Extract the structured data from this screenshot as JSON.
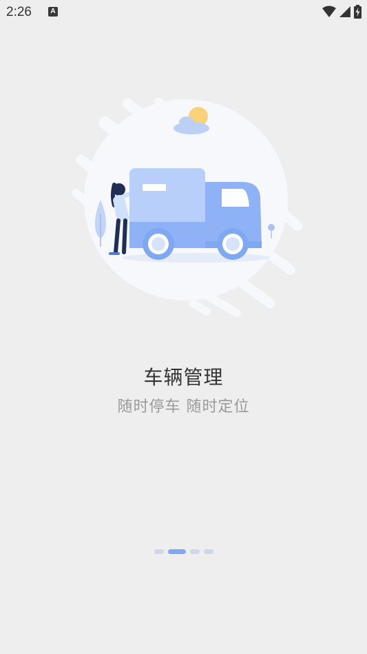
{
  "status_bar": {
    "time": "2:26",
    "notification_icon": "a-notification-icon",
    "wifi_icon": "wifi-icon",
    "signal_icon": "cell-signal-icon",
    "battery_icon": "battery-charging-icon"
  },
  "onboarding": {
    "illustration": "delivery-truck-illustration",
    "title": "车辆管理",
    "subtitle": "随时停车 随时定位"
  },
  "pager": {
    "total": 4,
    "active_index": 1
  },
  "colors": {
    "background": "#eeeeee",
    "accent": "#7fa8f2",
    "truck_body": "#8fb2f7",
    "truck_cargo": "#b8cff9",
    "dot_inactive": "#cfd8ea"
  }
}
